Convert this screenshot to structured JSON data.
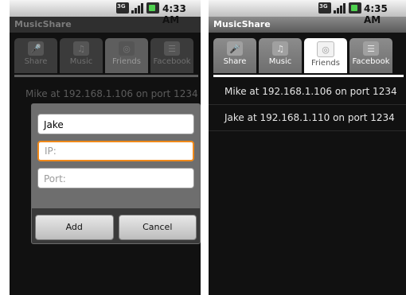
{
  "left_screen": {
    "status": {
      "time": "4:33 AM"
    },
    "app_title": "MusicShare",
    "tabs": [
      {
        "label": "Share",
        "icon": "mic-icon"
      },
      {
        "label": "Music",
        "icon": "music-note-icon"
      },
      {
        "label": "Friends",
        "icon": "friends-disc-icon"
      },
      {
        "label": "Facebook",
        "icon": "list-icon"
      }
    ],
    "friends": [
      "Mike at 192.168.1.106 on port 1234"
    ],
    "dialog": {
      "name_value": "Jake",
      "ip_placeholder": "IP:",
      "port_placeholder": "Port:",
      "add_label": "Add",
      "cancel_label": "Cancel"
    }
  },
  "right_screen": {
    "status": {
      "time": "4:35 AM"
    },
    "app_title": "MusicShare",
    "tabs": [
      {
        "label": "Share",
        "icon": "mic-icon"
      },
      {
        "label": "Music",
        "icon": "music-note-icon"
      },
      {
        "label": "Friends",
        "icon": "friends-disc-icon"
      },
      {
        "label": "Facebook",
        "icon": "list-icon"
      }
    ],
    "friends": [
      "Mike at 192.168.1.106 on port 1234",
      "Jake at 192.168.1.110 on port 1234"
    ]
  }
}
